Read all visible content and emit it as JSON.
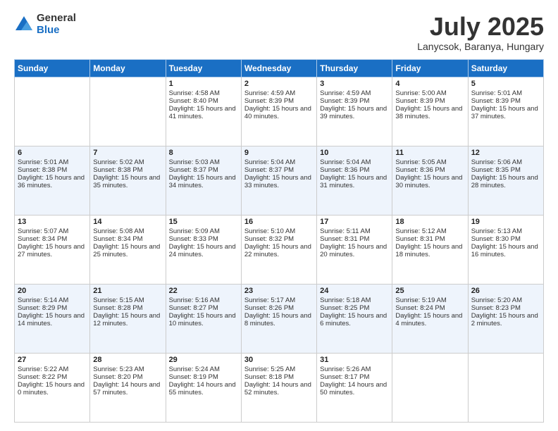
{
  "logo": {
    "general": "General",
    "blue": "Blue"
  },
  "header": {
    "month": "July 2025",
    "location": "Lanycsok, Baranya, Hungary"
  },
  "weekdays": [
    "Sunday",
    "Monday",
    "Tuesday",
    "Wednesday",
    "Thursday",
    "Friday",
    "Saturday"
  ],
  "weeks": [
    [
      {
        "day": "",
        "sunrise": "",
        "sunset": "",
        "daylight": ""
      },
      {
        "day": "",
        "sunrise": "",
        "sunset": "",
        "daylight": ""
      },
      {
        "day": "1",
        "sunrise": "Sunrise: 4:58 AM",
        "sunset": "Sunset: 8:40 PM",
        "daylight": "Daylight: 15 hours and 41 minutes."
      },
      {
        "day": "2",
        "sunrise": "Sunrise: 4:59 AM",
        "sunset": "Sunset: 8:39 PM",
        "daylight": "Daylight: 15 hours and 40 minutes."
      },
      {
        "day": "3",
        "sunrise": "Sunrise: 4:59 AM",
        "sunset": "Sunset: 8:39 PM",
        "daylight": "Daylight: 15 hours and 39 minutes."
      },
      {
        "day": "4",
        "sunrise": "Sunrise: 5:00 AM",
        "sunset": "Sunset: 8:39 PM",
        "daylight": "Daylight: 15 hours and 38 minutes."
      },
      {
        "day": "5",
        "sunrise": "Sunrise: 5:01 AM",
        "sunset": "Sunset: 8:39 PM",
        "daylight": "Daylight: 15 hours and 37 minutes."
      }
    ],
    [
      {
        "day": "6",
        "sunrise": "Sunrise: 5:01 AM",
        "sunset": "Sunset: 8:38 PM",
        "daylight": "Daylight: 15 hours and 36 minutes."
      },
      {
        "day": "7",
        "sunrise": "Sunrise: 5:02 AM",
        "sunset": "Sunset: 8:38 PM",
        "daylight": "Daylight: 15 hours and 35 minutes."
      },
      {
        "day": "8",
        "sunrise": "Sunrise: 5:03 AM",
        "sunset": "Sunset: 8:37 PM",
        "daylight": "Daylight: 15 hours and 34 minutes."
      },
      {
        "day": "9",
        "sunrise": "Sunrise: 5:04 AM",
        "sunset": "Sunset: 8:37 PM",
        "daylight": "Daylight: 15 hours and 33 minutes."
      },
      {
        "day": "10",
        "sunrise": "Sunrise: 5:04 AM",
        "sunset": "Sunset: 8:36 PM",
        "daylight": "Daylight: 15 hours and 31 minutes."
      },
      {
        "day": "11",
        "sunrise": "Sunrise: 5:05 AM",
        "sunset": "Sunset: 8:36 PM",
        "daylight": "Daylight: 15 hours and 30 minutes."
      },
      {
        "day": "12",
        "sunrise": "Sunrise: 5:06 AM",
        "sunset": "Sunset: 8:35 PM",
        "daylight": "Daylight: 15 hours and 28 minutes."
      }
    ],
    [
      {
        "day": "13",
        "sunrise": "Sunrise: 5:07 AM",
        "sunset": "Sunset: 8:34 PM",
        "daylight": "Daylight: 15 hours and 27 minutes."
      },
      {
        "day": "14",
        "sunrise": "Sunrise: 5:08 AM",
        "sunset": "Sunset: 8:34 PM",
        "daylight": "Daylight: 15 hours and 25 minutes."
      },
      {
        "day": "15",
        "sunrise": "Sunrise: 5:09 AM",
        "sunset": "Sunset: 8:33 PM",
        "daylight": "Daylight: 15 hours and 24 minutes."
      },
      {
        "day": "16",
        "sunrise": "Sunrise: 5:10 AM",
        "sunset": "Sunset: 8:32 PM",
        "daylight": "Daylight: 15 hours and 22 minutes."
      },
      {
        "day": "17",
        "sunrise": "Sunrise: 5:11 AM",
        "sunset": "Sunset: 8:31 PM",
        "daylight": "Daylight: 15 hours and 20 minutes."
      },
      {
        "day": "18",
        "sunrise": "Sunrise: 5:12 AM",
        "sunset": "Sunset: 8:31 PM",
        "daylight": "Daylight: 15 hours and 18 minutes."
      },
      {
        "day": "19",
        "sunrise": "Sunrise: 5:13 AM",
        "sunset": "Sunset: 8:30 PM",
        "daylight": "Daylight: 15 hours and 16 minutes."
      }
    ],
    [
      {
        "day": "20",
        "sunrise": "Sunrise: 5:14 AM",
        "sunset": "Sunset: 8:29 PM",
        "daylight": "Daylight: 15 hours and 14 minutes."
      },
      {
        "day": "21",
        "sunrise": "Sunrise: 5:15 AM",
        "sunset": "Sunset: 8:28 PM",
        "daylight": "Daylight: 15 hours and 12 minutes."
      },
      {
        "day": "22",
        "sunrise": "Sunrise: 5:16 AM",
        "sunset": "Sunset: 8:27 PM",
        "daylight": "Daylight: 15 hours and 10 minutes."
      },
      {
        "day": "23",
        "sunrise": "Sunrise: 5:17 AM",
        "sunset": "Sunset: 8:26 PM",
        "daylight": "Daylight: 15 hours and 8 minutes."
      },
      {
        "day": "24",
        "sunrise": "Sunrise: 5:18 AM",
        "sunset": "Sunset: 8:25 PM",
        "daylight": "Daylight: 15 hours and 6 minutes."
      },
      {
        "day": "25",
        "sunrise": "Sunrise: 5:19 AM",
        "sunset": "Sunset: 8:24 PM",
        "daylight": "Daylight: 15 hours and 4 minutes."
      },
      {
        "day": "26",
        "sunrise": "Sunrise: 5:20 AM",
        "sunset": "Sunset: 8:23 PM",
        "daylight": "Daylight: 15 hours and 2 minutes."
      }
    ],
    [
      {
        "day": "27",
        "sunrise": "Sunrise: 5:22 AM",
        "sunset": "Sunset: 8:22 PM",
        "daylight": "Daylight: 15 hours and 0 minutes."
      },
      {
        "day": "28",
        "sunrise": "Sunrise: 5:23 AM",
        "sunset": "Sunset: 8:20 PM",
        "daylight": "Daylight: 14 hours and 57 minutes."
      },
      {
        "day": "29",
        "sunrise": "Sunrise: 5:24 AM",
        "sunset": "Sunset: 8:19 PM",
        "daylight": "Daylight: 14 hours and 55 minutes."
      },
      {
        "day": "30",
        "sunrise": "Sunrise: 5:25 AM",
        "sunset": "Sunset: 8:18 PM",
        "daylight": "Daylight: 14 hours and 52 minutes."
      },
      {
        "day": "31",
        "sunrise": "Sunrise: 5:26 AM",
        "sunset": "Sunset: 8:17 PM",
        "daylight": "Daylight: 14 hours and 50 minutes."
      },
      {
        "day": "",
        "sunrise": "",
        "sunset": "",
        "daylight": ""
      },
      {
        "day": "",
        "sunrise": "",
        "sunset": "",
        "daylight": ""
      }
    ]
  ]
}
